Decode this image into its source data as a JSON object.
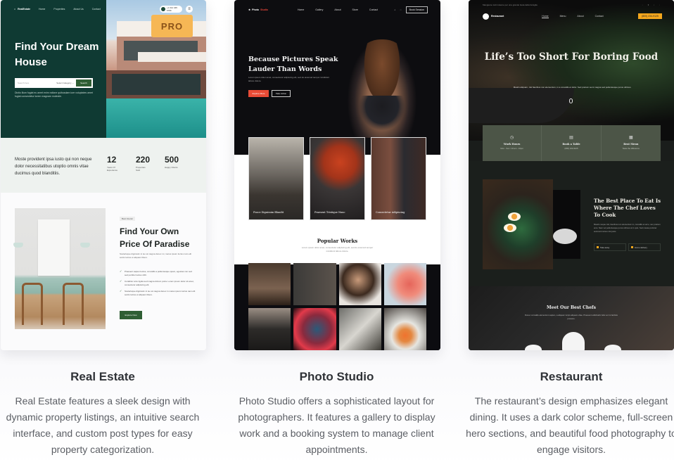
{
  "cards": [
    {
      "title": "Real Estate",
      "description": "Real Estate features a sleek design with dynamic property listings, an intuitive search interface, and custom post types for easy property categorization.",
      "badge": "PRO",
      "preview": {
        "logo": "RealEstate",
        "nav": [
          "Home",
          "Properties",
          "About Us",
          "Contact"
        ],
        "phone": "+1 012 345 6789",
        "hero_title": "Find Your Dream House",
        "search_placeholder": "Search here",
        "search_category": "Select Category ⌄",
        "search_button": "Search",
        "hero_desc": "Dictio illum fugiat eu amet enim ratione quibusdam iure voluptates amet fugiat consectetur lorem magnam molestie.",
        "stats_text": "Moste provident ipsa iusto qui non neque dolor necessitatibus utoptio omnis vitae ducimus quod blanditiis.",
        "stats": [
          {
            "value": "12",
            "label": "Years Of Experience"
          },
          {
            "value": "220",
            "label": "Properties Sold"
          },
          {
            "value": "500",
            "label": "Happy Clients"
          }
        ],
        "section_tag": "Best Interior",
        "section_title": "Find Your Own Price Of Paradise",
        "section_desc": "Scelerisque dignissim in leo at magna donec mi, metus ipsum luctus nam elit sociis luctus et aliquam libero.",
        "features": [
          "Praesent sapien lectus, convallis a pellentesque quam, egestas non sed sed porttitor lectus nibh.",
          "Curabitur arcu ligula sed magna dictum porta. Lorem ipsum dolor sit amet, consectetur adipiscing elit.",
          "Scelerisque dignissim in leo at magna donec in metus ipsum luctus nam elit sociis luctus et aliquam libero."
        ],
        "cta": "Explore Now"
      }
    },
    {
      "title": "Photo Studio",
      "description": "Photo Studio offers a sophisticated layout for photographers. It features a gallery to display work and a booking system to manage client appointments.",
      "preview": {
        "logo_a": "Photo",
        "logo_b": "Studio",
        "nav": [
          "Home",
          "Gallery",
          "About",
          "Store",
          "Contact"
        ],
        "book_button": "Book Session",
        "hero_title": "Because Pictures Speak Lauder Than Words",
        "hero_desc": "Lorem ipsum dolor amet, consectetur adipiscing elit, sed do eiusmod tempor incididunt labore dolore.",
        "btn_primary": "Explore More",
        "btn_secondary": "Take Action",
        "portfolio": [
          "Fusce Dignissim Blandit",
          "Praesent Tristique Nunc",
          "Consectetur Adipiscing"
        ],
        "popular_title": "Popular Works",
        "popular_desc": "Lorem ipsum dolor amet, consectetur adipiscing elit, sed do eiusmod tempor incididunt labore dolore."
      }
    },
    {
      "title": "Restaurant",
      "description": "The restaurant’s design emphasizes elegant dining. It uses a dark color scheme, full-screen hero sections, and beautiful food photography to engage visitors.",
      "preview": {
        "topbar": "Mangiamo tutti insieme per una grande festa della famiglia",
        "socials": "◦ ▾ ▫ ◦",
        "logo": "Restaurant",
        "nav": [
          "Home",
          "Menu",
          "About",
          "Contact"
        ],
        "cta": "(800) 234-9125",
        "hero_title": "Life’s Too Short For Boring Food",
        "hero_desc": "Mauris aliquam, nisi faucibus non elementum, in a convallis et dolor. Sed pretium semi magna sed pellentesque purus ultrices.",
        "info": [
          {
            "icon": "◷",
            "title": "Work Hours",
            "text": "Mon - Sun / 10 am - 10pm"
          },
          {
            "icon": "▤",
            "title": "Book a Table",
            "text": "(800) 234-9125"
          },
          {
            "icon": "▦",
            "title": "Best Menu",
            "text": "Taste the difference"
          }
        ],
        "section_title": "The Best Place To Eat Is Where The Chef Loves To Cook",
        "section_desc": "Mauris neque nisl, faucibus non elementum in, convallis et arcu, nec pretium eros. Nam vel pellentesque purus ultrices at in quis. Sed massa pulvinar euismod cursus nisi justo.",
        "features": [
          "Take away",
          "Home delivery"
        ],
        "chefs_title": "Meet Our Best Chefs",
        "chefs_desc": "Donec convallis elementum sapien, a aliquam turpis aliquam vitae. Praesent sollicitudin felis vel mi facilisis posuere."
      }
    }
  ],
  "colors": {
    "re_green": "#0f3a33",
    "pro_badge": "#f6b755",
    "ps_accent": "#e74b36",
    "rs_accent": "#f4a71d"
  }
}
